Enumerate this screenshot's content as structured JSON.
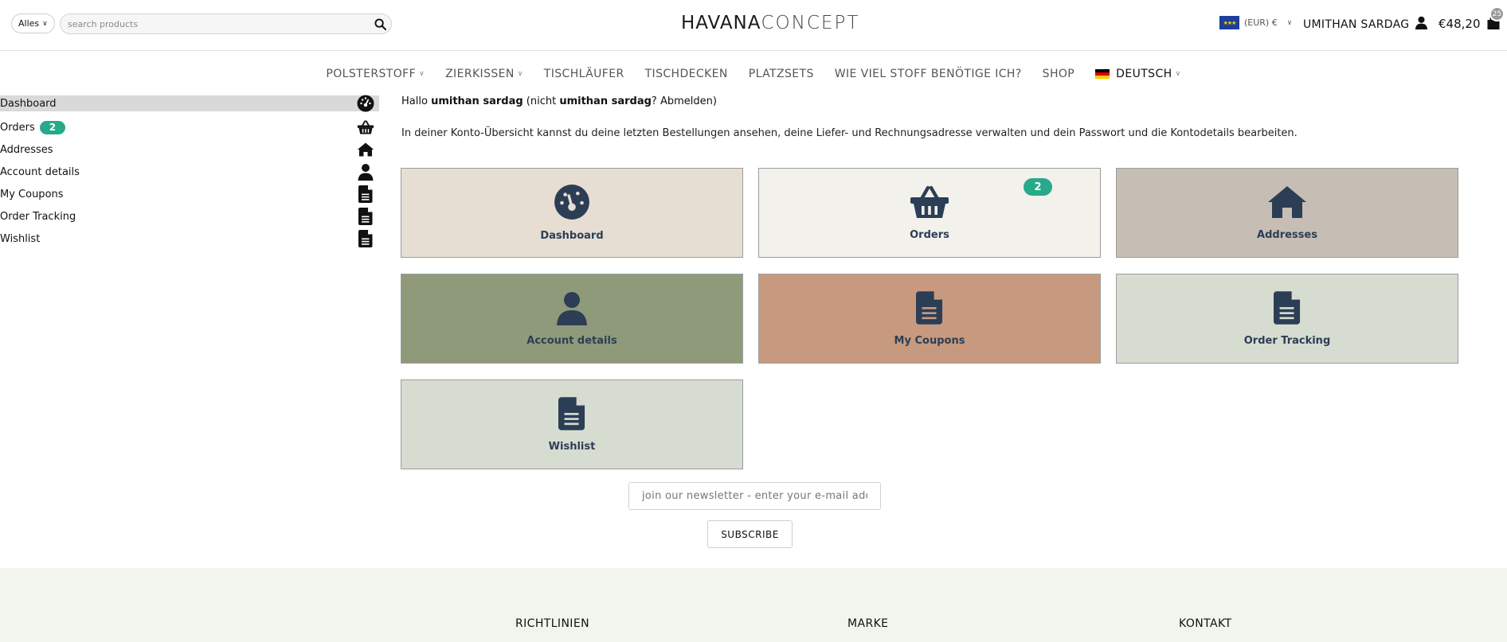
{
  "header": {
    "category_select": "Alles",
    "search_placeholder": "search products",
    "logo_part1": "HAVANA",
    "logo_part2": "CONCEPT",
    "eu_flag_stars": "★★★",
    "currency": "(EUR) €",
    "account_name": "UMITHAN SARDAG",
    "cart_total": "€48,20",
    "cart_count": "25"
  },
  "nav": {
    "items": [
      {
        "label": "POLSTERSTOFF"
      },
      {
        "label": "ZIERKISSEN"
      },
      {
        "label": "TISCHLÄUFER"
      },
      {
        "label": "TISCHDECKEN"
      },
      {
        "label": "PLATZSETS"
      },
      {
        "label": "WIE VIEL STOFF BENÖTIGE ICH?"
      },
      {
        "label": "SHOP"
      }
    ],
    "language": "DEUTSCH"
  },
  "sidebar": {
    "items": [
      {
        "label": "Dashboard",
        "icon": "dashboard-icon"
      },
      {
        "label": "Orders",
        "badge": "2",
        "icon": "basket-icon"
      },
      {
        "label": "Addresses",
        "icon": "home-icon"
      },
      {
        "label": "Account details",
        "icon": "user-icon"
      },
      {
        "label": "My Coupons",
        "icon": "document-icon"
      },
      {
        "label": "Order Tracking",
        "icon": "document-icon"
      },
      {
        "label": "Wishlist",
        "icon": "document-icon"
      }
    ]
  },
  "main": {
    "greeting": {
      "hello": "Hallo ",
      "user": "umithan sardag",
      "not_prefix": " (nicht ",
      "user2": "umithan sardag",
      "logout": "? Abmelden)"
    },
    "intro": "In deiner Konto-Übersicht kannst du deine letzten Bestellungen ansehen, deine Liefer- und Rechnungsadresse verwalten und dein Passwort und die Kontodetails bearbeiten.",
    "tiles": [
      {
        "label": "Dashboard",
        "color": "#e6ded3",
        "icon": "dashboard-icon"
      },
      {
        "label": "Orders",
        "color": "#f3f1ec",
        "icon": "basket-icon",
        "badge": "2"
      },
      {
        "label": "Addresses",
        "color": "#c6bdb5",
        "icon": "home-icon"
      },
      {
        "label": "Account details",
        "color": "#8f9a7a",
        "icon": "user-icon"
      },
      {
        "label": "My Coupons",
        "color": "#c79a80",
        "icon": "document-icon"
      },
      {
        "label": "Order Tracking",
        "color": "#d7dcd1",
        "icon": "document-icon"
      },
      {
        "label": "Wishlist",
        "color": "#d7dcd1",
        "icon": "document-icon"
      }
    ]
  },
  "newsletter": {
    "placeholder": "join our newsletter - enter your e-mail address",
    "button": "SUBSCRIBE"
  },
  "footer": {
    "headings": [
      "RICHTLINIEN",
      "MARKE",
      "KONTAKT"
    ]
  },
  "colors": {
    "badge": "#28a98a",
    "icon_dark": "#2c3e55"
  }
}
